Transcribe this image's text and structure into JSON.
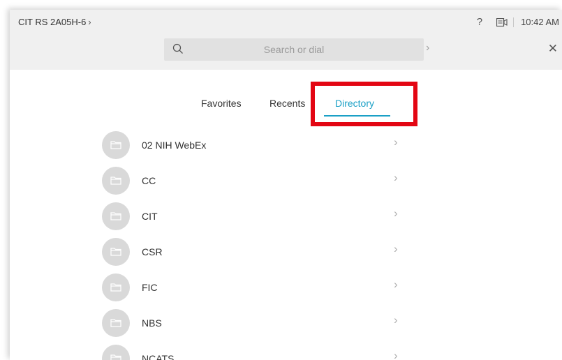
{
  "header": {
    "device_name": "CIT RS 2A05H-6",
    "device_chevron": "›",
    "help": "?",
    "time": "10:42 AM"
  },
  "search": {
    "placeholder": "Search or dial",
    "go": "›",
    "close": "✕"
  },
  "tabs": [
    {
      "label": "Favorites",
      "active": false
    },
    {
      "label": "Recents",
      "active": false
    },
    {
      "label": "Directory",
      "active": true
    }
  ],
  "directory": [
    {
      "label": "02 NIH WebEx"
    },
    {
      "label": "CC"
    },
    {
      "label": "CIT"
    },
    {
      "label": "CSR"
    },
    {
      "label": "FIC"
    },
    {
      "label": "NBS"
    },
    {
      "label": "NCATS"
    }
  ],
  "colors": {
    "accent": "#1aa0c6",
    "highlight": "#e30613"
  }
}
